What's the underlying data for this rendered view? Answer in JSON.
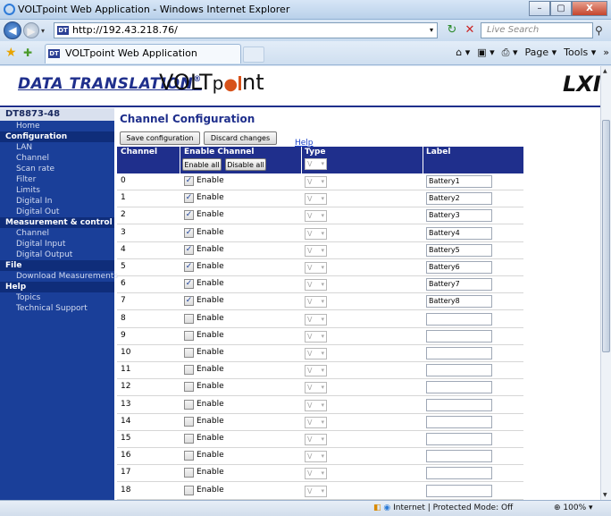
{
  "window": {
    "title": "VOLTpoint Web Application - Windows Internet Explorer",
    "min": "–",
    "max": "▢",
    "close": "X"
  },
  "address": {
    "url": "http://192.43.218.76/",
    "search_placeholder": "Live Search",
    "favicon": "DT"
  },
  "tab": {
    "label": "VOLTpoint Web Application"
  },
  "commands": {
    "home": "⌂ ▾",
    "feeds": "▣ ▾",
    "print": "⎙ ▾",
    "page": "Page ▾",
    "tools": "Tools ▾",
    "more": "»"
  },
  "banner": {
    "brand": "DATA TRANSLATION",
    "reg": "®",
    "product": "VOLTpoint",
    "product_prefix": "VOLT",
    "product_suffix": "nt",
    "lxi": "LXI"
  },
  "sidebar": {
    "device": "DT8873-48",
    "items": [
      {
        "kind": "item",
        "label": "Home"
      },
      {
        "kind": "section",
        "label": "Configuration"
      },
      {
        "kind": "item",
        "label": "LAN"
      },
      {
        "kind": "item",
        "label": "Channel"
      },
      {
        "kind": "item",
        "label": "Scan rate"
      },
      {
        "kind": "item",
        "label": "Filter"
      },
      {
        "kind": "item",
        "label": "Limits"
      },
      {
        "kind": "item",
        "label": "Digital In"
      },
      {
        "kind": "item",
        "label": "Digital Out"
      },
      {
        "kind": "section",
        "label": "Measurement & control"
      },
      {
        "kind": "item",
        "label": "Channel"
      },
      {
        "kind": "item",
        "label": "Digital Input"
      },
      {
        "kind": "item",
        "label": "Digital Output"
      },
      {
        "kind": "section",
        "label": "File"
      },
      {
        "kind": "item",
        "label": "Download Measurements"
      },
      {
        "kind": "section",
        "label": "Help"
      },
      {
        "kind": "item",
        "label": "Topics"
      },
      {
        "kind": "item",
        "label": "Technical Support"
      }
    ]
  },
  "main": {
    "heading": "Channel Configuration",
    "save_label": "Save configuration",
    "discard_label": "Discard changes",
    "help_label": "Help",
    "enable_all_label": "Enable all",
    "disable_all_label": "Disable all",
    "columns": {
      "channel": "Channel",
      "enable": "Enable Channel",
      "type": "Type",
      "label": "Label"
    },
    "type_default": "V",
    "enable_text": "Enable",
    "rows": [
      {
        "channel": "0",
        "enabled": true,
        "type": "V",
        "label": "Battery1"
      },
      {
        "channel": "1",
        "enabled": true,
        "type": "V",
        "label": "Battery2"
      },
      {
        "channel": "2",
        "enabled": true,
        "type": "V",
        "label": "Battery3"
      },
      {
        "channel": "3",
        "enabled": true,
        "type": "V",
        "label": "Battery4"
      },
      {
        "channel": "4",
        "enabled": true,
        "type": "V",
        "label": "Battery5"
      },
      {
        "channel": "5",
        "enabled": true,
        "type": "V",
        "label": "Battery6"
      },
      {
        "channel": "6",
        "enabled": true,
        "type": "V",
        "label": "Battery7"
      },
      {
        "channel": "7",
        "enabled": true,
        "type": "V",
        "label": "Battery8"
      },
      {
        "channel": "8",
        "enabled": false,
        "type": "V",
        "label": ""
      },
      {
        "channel": "9",
        "enabled": false,
        "type": "V",
        "label": ""
      },
      {
        "channel": "10",
        "enabled": false,
        "type": "V",
        "label": ""
      },
      {
        "channel": "11",
        "enabled": false,
        "type": "V",
        "label": ""
      },
      {
        "channel": "12",
        "enabled": false,
        "type": "V",
        "label": ""
      },
      {
        "channel": "13",
        "enabled": false,
        "type": "V",
        "label": ""
      },
      {
        "channel": "14",
        "enabled": false,
        "type": "V",
        "label": ""
      },
      {
        "channel": "15",
        "enabled": false,
        "type": "V",
        "label": ""
      },
      {
        "channel": "16",
        "enabled": false,
        "type": "V",
        "label": ""
      },
      {
        "channel": "17",
        "enabled": false,
        "type": "V",
        "label": ""
      },
      {
        "channel": "18",
        "enabled": false,
        "type": "V",
        "label": ""
      }
    ]
  },
  "status": {
    "zone": "Internet | Protected Mode: Off",
    "zoom": "100%"
  },
  "colors": {
    "accent": "#1f2f8c",
    "sidebar": "#1a3f99"
  }
}
